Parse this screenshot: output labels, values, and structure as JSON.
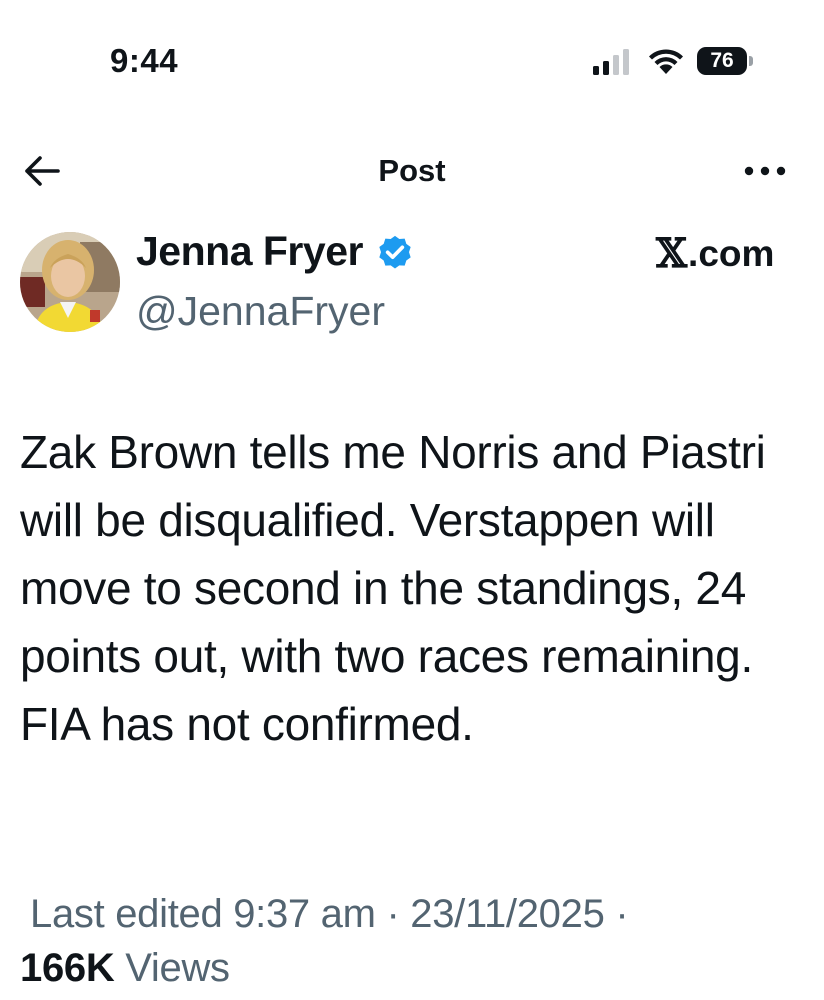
{
  "status_bar": {
    "time": "9:44",
    "battery": "76",
    "icons": [
      "signal-icon",
      "wifi-icon",
      "battery-icon"
    ]
  },
  "nav": {
    "title": "Post",
    "back_icon": "arrow-left-icon",
    "more_icon": "more-horizontal-icon"
  },
  "post": {
    "author_name": "Jenna Fryer",
    "author_handle": "@JennaFryer",
    "verified": true,
    "source_logo_glyph": "𝕏",
    "source_logo_text": ".com",
    "text": "Zak Brown tells me Norris and Piastri will be disqualified. Verstappen will move to second in the standings, 24 points out, with two races remaining. FIA has not confirmed.",
    "meta": "Last edited 9:37 am · 23/11/2025  ·",
    "views_count": "166K",
    "views_label": "Views"
  },
  "colors": {
    "text_primary": "#0f1419",
    "text_secondary": "#536471",
    "verified_blue": "#1d9bf0"
  }
}
